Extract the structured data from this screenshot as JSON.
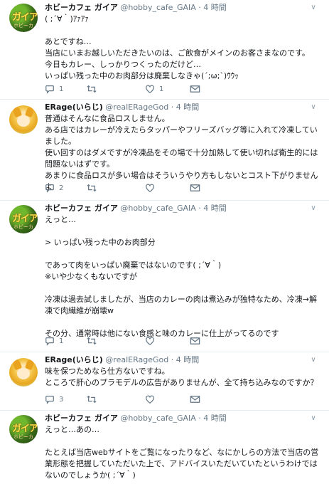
{
  "tweets": [
    {
      "name": "ホビーカフェ ガイア",
      "handle": "@hobby_cafe_GAIA",
      "time": "4 時間",
      "text": "( ;´∀｀)ｱｧｱｧ\n\nあとですね…\n当店にいまお越しいただきたいのは、ご飲食がメインのお客さまなのです。\n今日もカレー、しっかりつくったのだけど…\nいっぱい残った中のお肉部分は廃棄しなきゃ(´;ω;`)ｳｳｯ",
      "reply_count": "1",
      "retweet_count": "",
      "like_count": "1"
    },
    {
      "name": "ERage(いらじ)",
      "handle": "@realERageGod",
      "time": "4 時間",
      "text": "普通はそんなに食品ロスしません。\nある店ではカレーが冷えたらタッパーやフリーズバッグ等に入れて冷凍していました。\n使い回すのはダメですが冷凍品をその場で十分加熱して使い切れば衛生的には問題ないはずです。\nあまりに食品ロスが多い場合はそういうやり方もしないとコスト下がりませんよ",
      "reply_count": "2",
      "retweet_count": "",
      "like_count": ""
    },
    {
      "name": "ホビーカフェ ガイア",
      "handle": "@hobby_cafe_GAIA",
      "time": "4 時間",
      "text": "えっと…\n\n> いっぱい残った中のお肉部分\n\nであって肉をいっぱい廃棄ではないのです( ;´∀｀)\n※いや少なくもないですが\n\n冷凍は過去試しましたが、当店のカレーの肉は煮込みが独特なため、冷凍→解凍で肉繊維が崩壊w\n\nその分、通常時は他にない食感と味のカレーに仕上がってるのです",
      "reply_count": "1",
      "retweet_count": "",
      "like_count": ""
    },
    {
      "name": "ERage(いらじ)",
      "handle": "@realERageGod",
      "time": "4 時間",
      "text": "味を保つためなら仕方ないですね。\nところで肝心のプラモデルの広告がありませんが、全て持ち込みなのですか？",
      "reply_count": "3",
      "retweet_count": "",
      "like_count": ""
    },
    {
      "name": "ホビーカフェ ガイア",
      "handle": "@hobby_cafe_GAIA",
      "time": "4 時間",
      "text": "えっと…あの…\n\nたとえば当店webサイトをご覧になったりなど、なにかしらの方法で当店の営業形態を把握していただいた上で、アドバイスいただいていたというわけではないのでしょうか( ;´∀｀)",
      "reply_count": "",
      "retweet_count": "",
      "like_count": ""
    }
  ],
  "avatar_logo_text": [
    "ガイア",
    "ホビーカフェ"
  ],
  "colors": {
    "text": "#14171a",
    "meta": "#657786",
    "divider": "#e6ecf0",
    "icon": "#657786"
  },
  "icons": [
    "reply-icon",
    "retweet-icon",
    "like-icon",
    "mail-icon",
    "chevron-down-icon"
  ]
}
